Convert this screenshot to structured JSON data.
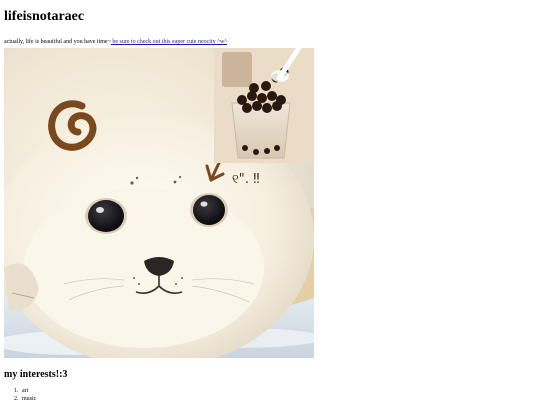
{
  "header": {
    "title": "lifeisnotaraec"
  },
  "intro": {
    "text": "actually, life is beautiful and you have time~",
    "link_text": " be sure to check out this super cute neocity ^w^"
  },
  "image": {
    "annotation_text": "୧\"․ ‼"
  },
  "interests": {
    "heading": "my interests!:3",
    "items": [
      "art",
      "music"
    ]
  },
  "colors": {
    "link": "#1a1aa6",
    "background": "#ffffff",
    "drawing": "#7a4a1e"
  }
}
